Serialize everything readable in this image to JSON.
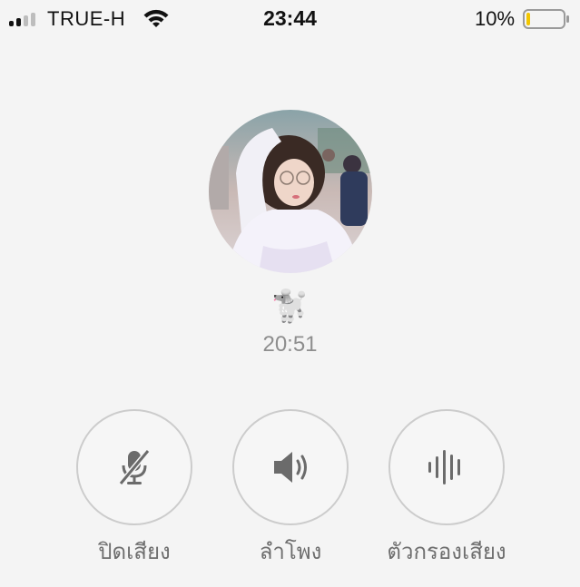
{
  "status_bar": {
    "carrier": "TRUE-H",
    "time": "23:44",
    "battery_percent": "10%",
    "battery_level": 0.1,
    "signal_bars_filled": 2,
    "signal_bars_total": 4,
    "battery_color": "#f2c600"
  },
  "call": {
    "caller_name": "🐩",
    "duration": "20:51",
    "avatar_icon": "avatar-photo"
  },
  "controls": [
    {
      "label": "ปิดเสียง",
      "icon": "mic-off-icon"
    },
    {
      "label": "ลำโพง",
      "icon": "speaker-icon"
    },
    {
      "label": "ตัวกรองเสียง",
      "icon": "sound-filter-icon"
    }
  ],
  "colors": {
    "background": "#f4f4f4",
    "button_border": "#cccccc",
    "label_gray": "#6e6e6e",
    "timer_gray": "#8e8e8e",
    "icon_gray": "#6b6b6b"
  }
}
